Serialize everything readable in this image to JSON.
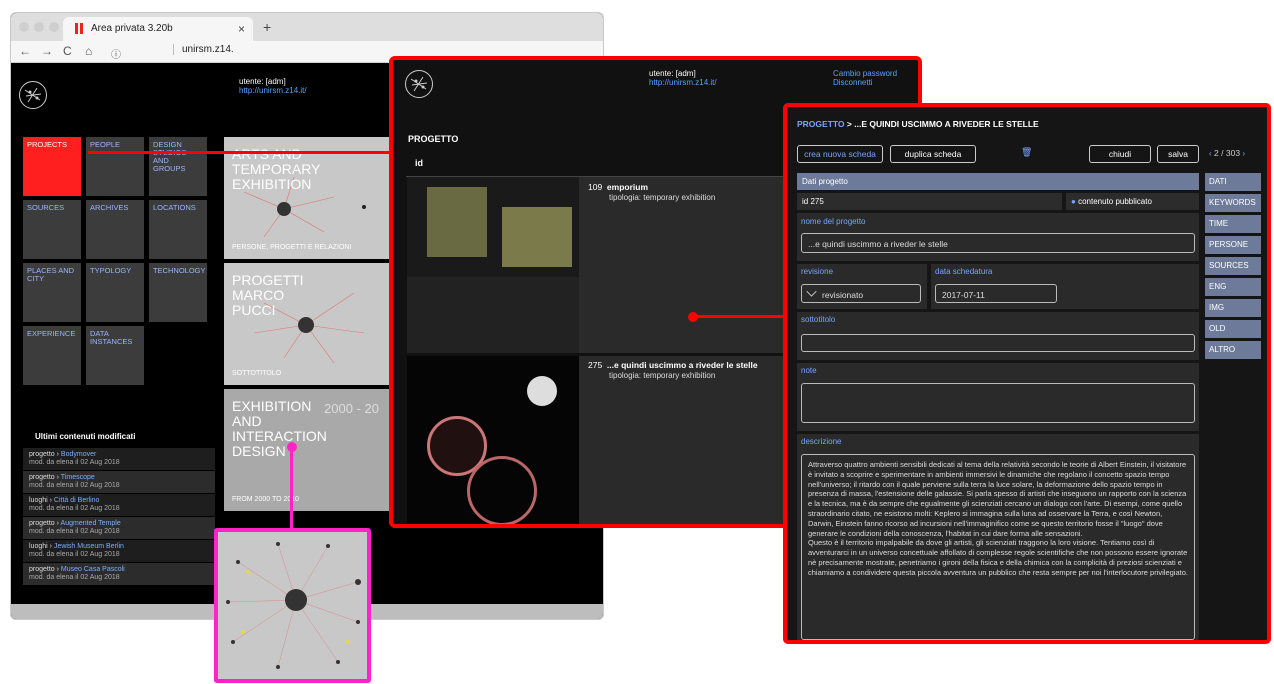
{
  "browser": {
    "tab_title": "Area privata 3.20b",
    "close": "×",
    "new_tab": "+",
    "url": "unirsm.z14.",
    "nav": {
      "back": "←",
      "forward": "→",
      "reload": "C",
      "home": "⌂",
      "info": "ⓘ"
    }
  },
  "site": {
    "user": "utente: [adm]",
    "link": "http://unirsm.z14.it/",
    "change_pw": "Cambio password",
    "logout": "Disconnetti"
  },
  "grid": [
    "PROJECTS",
    "PEOPLE",
    "DESIGN STUDIOS AND GROUPS",
    "SOURCES",
    "ARCHIVES",
    "LOCATIONS",
    "PLACES AND CITY",
    "TYPOLOGY",
    "TECHNOLOGY",
    "EXPERIENCE",
    "DATA INSTANCES"
  ],
  "cards": [
    {
      "title": "ARTS AND TEMPORARY EXHIBITION",
      "sub": "PERSONE, PROGETTI E RELAZIONI"
    },
    {
      "title": "PROGETTI MARCO PUCCI",
      "sub": "SOTTOTITOLO"
    },
    {
      "title": "EXHIBITION AND INTERACTION DESIGN",
      "sub": "FROM 2000 TO 2010",
      "year": "2000 - 20"
    }
  ],
  "recent": {
    "heading": "Ultimi contenuti modificati",
    "items": [
      {
        "type": "progetto",
        "name": "Bodymover",
        "sub": "mod. da elena il 02 Aug 2018"
      },
      {
        "type": "progetto",
        "name": "Timescope",
        "sub": "mod. da elena il 02 Aug 2018"
      },
      {
        "type": "luoghi",
        "name": "Città di Berlino",
        "sub": "mod. da elena il 02 Aug 2018"
      },
      {
        "type": "progetto",
        "name": "Augmented Temple",
        "sub": "mod. da elena il 02 Aug 2018"
      },
      {
        "type": "luoghi",
        "name": "Jewish Museum Berlin",
        "sub": "mod. da elena il 02 Aug 2018"
      },
      {
        "type": "progetto",
        "name": "Museo Casa Pascoli",
        "sub": "mod. da elena il 02 Aug 2018"
      }
    ],
    "sep": " › "
  },
  "list": {
    "title": "PROGETTO",
    "col_id": "id",
    "rows": [
      {
        "id": "109",
        "name": "emporium",
        "type": "tipologia: temporary exhibition"
      },
      {
        "id": "275",
        "name": "...e quindi uscimmo a riveder le stelle",
        "type": "tipologia: temporary exhibition"
      }
    ]
  },
  "form": {
    "breadcrumb_root": "PROGETTO",
    "breadcrumb_sep": " > ",
    "breadcrumb_title": "...E QUINDI USCIMMO A RIVEDER LE STELLE",
    "btn_new": "crea nuova scheda",
    "btn_dup": "duplica scheda",
    "btn_close": "chiudi",
    "btn_save": "salva",
    "trash_icon": "🗑",
    "pager": "2 / 303",
    "prev": "‹",
    "next": "›",
    "section": "Dati progetto",
    "id_value": "id 275",
    "published": "contenuto pubblicato",
    "name_label": "nome del progetto",
    "name_value": "...e quindi uscimmo a riveder le stelle",
    "rev_label": "revisione",
    "rev_value": "revisionato",
    "date_label": "data schedatura",
    "date_value": "2017-07-11",
    "subtitle_label": "sottotitolo",
    "notes_label": "note",
    "desc_label": "descrizione",
    "description": "Attraverso quattro ambienti sensibili dedicati al tema della relatività secondo le teorie di Albert Einstein, il visitatore è invitato a scoprire e sperimentare in ambienti immersivi le dinamiche che regolano il concetto spazio tempo nell'universo; il ritardo con il quale perviene sulla terra la luce solare, la deformazione dello spazio tempo in presenza di massa, l'estensione delle galassie. Si parla spesso di artisti che inseguono un rapporto con la scienza e la tecnica, ma è da sempre che egualmente gli scienziati cercano un dialogo con l'arte. Di esempi, come quello straordinario citato, ne esistono molti: Keplero si immagina sulla luna ad osservare la Terra, e così Newton, Darwin, Einstein fanno ricorso ad incursioni nell'immaginifico come se questo territorio fosse il \"luogo\" dove generare le condizioni della conoscenza, l'habitat in cui dare forma alle sensazioni.\nQuesto è il territorio impalpabile da dove gli artisti, gli scienziati traggono la loro visione. Tentiamo così di avventurarci in un universo concettuale affollato di complesse regole scientifiche che non possono essere ignorate nè precisamente mostrate, penetriamo i gironi della fisica e della chimica con la complicità di preziosi scienziati e chiamiamo a condividere questa piccola avventura un pubblico che resta sempre per noi l'interlocutore privilegiato.",
    "side_tabs": [
      "DATI",
      "KEYWORDS",
      "TIME",
      "PERSONE",
      "SOURCES",
      "ENG",
      "IMG",
      "OLD",
      "ALTRO"
    ]
  },
  "colors": {
    "highlight_red": "#ff0000",
    "magenta": "#ff23c8",
    "link_blue": "#5aa0ff",
    "tab_blue": "#6d7a9a"
  }
}
